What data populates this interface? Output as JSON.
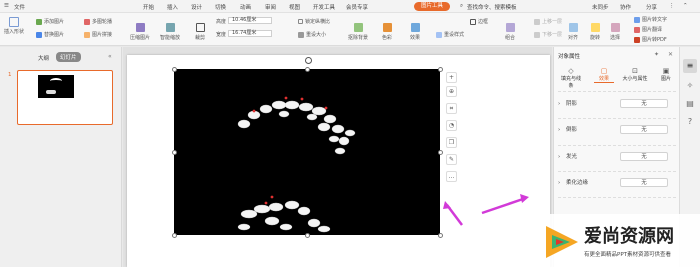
{
  "menu": {
    "file": "文件",
    "items": [
      "开始",
      "插入",
      "设计",
      "切换",
      "动画",
      "审阅",
      "视图",
      "开发工具",
      "会员专享"
    ],
    "active_tab": "图片工具",
    "search": "查找命令、搜索模板",
    "unsynced": "未同步",
    "collab": "协作",
    "share": "分享"
  },
  "ribbon": {
    "insert_shape": "插入形状",
    "add_picture": "添加图片",
    "replace_picture": "替换图片",
    "multi_outline": "多图轮播",
    "picture_stitch": "图片拼接",
    "compress": "压缩图片",
    "smart_scale": "智能缩放",
    "crop": "裁剪",
    "height_label": "高度",
    "height_value": "10.46厘米",
    "width_label": "宽度",
    "width_value": "16.74厘米",
    "lock_ratio": "锁定纵横比",
    "reset_size": "重设大小",
    "matting": "抠除背景",
    "color": "色彩",
    "effects": "效果",
    "reset_style": "重设样式",
    "border": "边框",
    "combine": "组合",
    "bring_forward": "上移一层",
    "send_backward": "下移一层",
    "align": "对齐",
    "rotate": "旋转",
    "select": "选择",
    "pic_to_text": "图片转文字",
    "pic_translate": "图片翻译",
    "pic_to_pdf": "图片转PDF"
  },
  "leftpanel": {
    "tab_outline": "大纲",
    "tab_slides": "幻灯片",
    "slide_number": "1"
  },
  "rightpanel": {
    "title": "对象属性",
    "tabs": [
      "填充与线条",
      "效果",
      "大小与属性",
      "图片"
    ],
    "rows": [
      {
        "label": "阴影",
        "value": "无"
      },
      {
        "label": "倒影",
        "value": "无"
      },
      {
        "label": "发光",
        "value": "无"
      },
      {
        "label": "柔化边缘",
        "value": "无"
      }
    ]
  },
  "watermark": {
    "main": "爱尚资源网",
    "sub": "有更全面精品PPT素材资源可供查看"
  },
  "colors": {
    "accent": "#e86a2b",
    "arrow": "#d23ad8"
  }
}
